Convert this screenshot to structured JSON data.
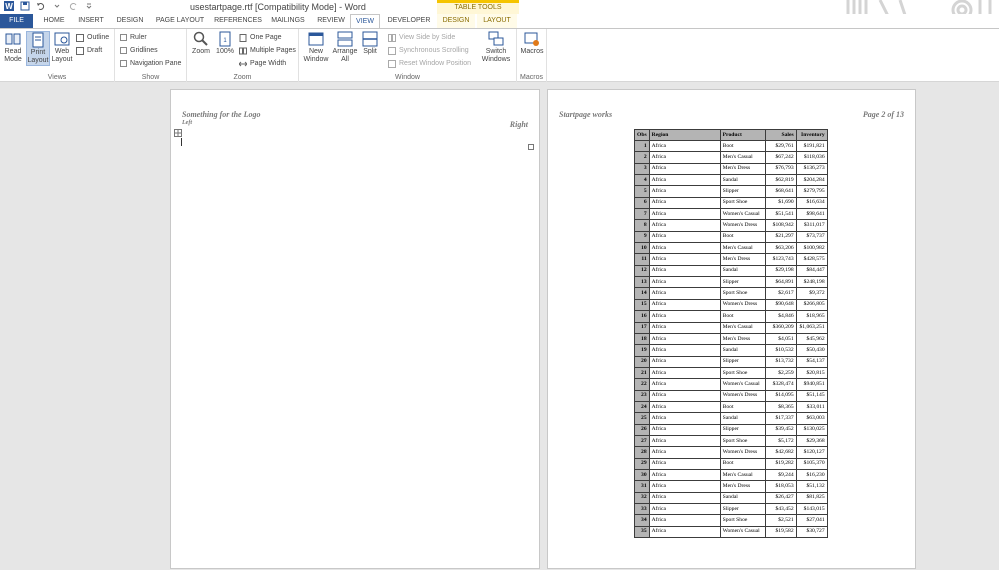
{
  "window": {
    "title": "usestartpage.rtf [Compatibility Mode] - Word",
    "contextual_header": "TABLE TOOLS"
  },
  "tabs": [
    {
      "label": "FILE"
    },
    {
      "label": "HOME"
    },
    {
      "label": "INSERT"
    },
    {
      "label": "DESIGN"
    },
    {
      "label": "PAGE LAYOUT"
    },
    {
      "label": "REFERENCES"
    },
    {
      "label": "MAILINGS"
    },
    {
      "label": "REVIEW"
    },
    {
      "label": "VIEW"
    },
    {
      "label": "DEVELOPER"
    },
    {
      "label": "DESIGN"
    },
    {
      "label": "LAYOUT"
    }
  ],
  "ribbon": {
    "views": {
      "label": "Views",
      "read_mode": "Read Mode",
      "print_layout": "Print Layout",
      "web_layout": "Web Layout",
      "outline": "Outline",
      "draft": "Draft"
    },
    "show": {
      "label": "Show",
      "ruler": "Ruler",
      "gridlines": "Gridlines",
      "navigation_pane": "Navigation Pane"
    },
    "zoom": {
      "label": "Zoom",
      "zoom": "Zoom",
      "hundred": "100%",
      "one_page": "One Page",
      "multiple_pages": "Multiple Pages",
      "page_width": "Page Width"
    },
    "window": {
      "label": "Window",
      "new_window": "New Window",
      "arrange_all": "Arrange All",
      "split": "Split",
      "view_side_by_side": "View Side by Side",
      "synchronous_scrolling": "Synchronous Scrolling",
      "reset_window_position": "Reset Window Position",
      "switch_windows": "Switch Windows"
    },
    "macros": {
      "label": "Macros",
      "macros": "Macros"
    }
  },
  "page1": {
    "header_logo": "Something for the Logo",
    "header_left": "Left",
    "header_right": "Right"
  },
  "page2": {
    "header_left": "Startpage works",
    "header_right": "Page 2 of 13",
    "table": {
      "columns": [
        "Obs",
        "Region",
        "Product",
        "Sales",
        "Inventory"
      ],
      "rows": [
        [
          "1",
          "Africa",
          "Boot",
          "$29,761",
          "$191,821"
        ],
        [
          "2",
          "Africa",
          "Men's Casual",
          "$67,242",
          "$118,036"
        ],
        [
          "3",
          "Africa",
          "Men's Dress",
          "$76,793",
          "$136,273"
        ],
        [
          "4",
          "Africa",
          "Sandal",
          "$62,819",
          "$204,284"
        ],
        [
          "5",
          "Africa",
          "Slipper",
          "$68,641",
          "$279,795"
        ],
        [
          "6",
          "Africa",
          "Sport Shoe",
          "$1,690",
          "$16,634"
        ],
        [
          "7",
          "Africa",
          "Women's Casual",
          "$51,541",
          "$98,641"
        ],
        [
          "8",
          "Africa",
          "Women's Dress",
          "$108,942",
          "$311,017"
        ],
        [
          "9",
          "Africa",
          "Boot",
          "$21,297",
          "$73,737"
        ],
        [
          "10",
          "Africa",
          "Men's Casual",
          "$63,206",
          "$100,982"
        ],
        [
          "11",
          "Africa",
          "Men's Dress",
          "$123,743",
          "$428,575"
        ],
        [
          "12",
          "Africa",
          "Sandal",
          "$29,198",
          "$84,447"
        ],
        [
          "13",
          "Africa",
          "Slipper",
          "$64,891",
          "$248,198"
        ],
        [
          "14",
          "Africa",
          "Sport Shoe",
          "$2,617",
          "$9,372"
        ],
        [
          "15",
          "Africa",
          "Women's Dress",
          "$90,648",
          "$266,805"
        ],
        [
          "16",
          "Africa",
          "Boot",
          "$4,846",
          "$18,965"
        ],
        [
          "17",
          "Africa",
          "Men's Casual",
          "$360,209",
          "$1,063,251"
        ],
        [
          "18",
          "Africa",
          "Men's Dress",
          "$4,051",
          "$45,962"
        ],
        [
          "19",
          "Africa",
          "Sandal",
          "$10,532",
          "$50,430"
        ],
        [
          "20",
          "Africa",
          "Slipper",
          "$13,732",
          "$54,137"
        ],
        [
          "21",
          "Africa",
          "Sport Shoe",
          "$2,259",
          "$20,815"
        ],
        [
          "22",
          "Africa",
          "Women's Casual",
          "$328,474",
          "$940,851"
        ],
        [
          "23",
          "Africa",
          "Women's Dress",
          "$14,095",
          "$51,145"
        ],
        [
          "24",
          "Africa",
          "Boot",
          "$8,365",
          "$33,011"
        ],
        [
          "25",
          "Africa",
          "Sandal",
          "$17,337",
          "$63,003"
        ],
        [
          "26",
          "Africa",
          "Slipper",
          "$39,452",
          "$130,025"
        ],
        [
          "27",
          "Africa",
          "Sport Shoe",
          "$5,172",
          "$29,368"
        ],
        [
          "28",
          "Africa",
          "Women's Dress",
          "$42,682",
          "$120,127"
        ],
        [
          "29",
          "Africa",
          "Boot",
          "$19,282",
          "$105,370"
        ],
        [
          "30",
          "Africa",
          "Men's Casual",
          "$9,244",
          "$16,230"
        ],
        [
          "31",
          "Africa",
          "Men's Dress",
          "$18,053",
          "$51,132"
        ],
        [
          "32",
          "Africa",
          "Sandal",
          "$26,427",
          "$81,825"
        ],
        [
          "33",
          "Africa",
          "Slipper",
          "$43,452",
          "$143,015"
        ],
        [
          "34",
          "Africa",
          "Sport Shoe",
          "$2,521",
          "$27,041"
        ],
        [
          "35",
          "Africa",
          "Women's Casual",
          "$19,582",
          "$30,727"
        ]
      ]
    }
  },
  "colors": {
    "file_tab": "#2b579a",
    "accent": "#2b579a",
    "contextual": "#f5c400",
    "table_header_bg": "#b4b4b4"
  }
}
